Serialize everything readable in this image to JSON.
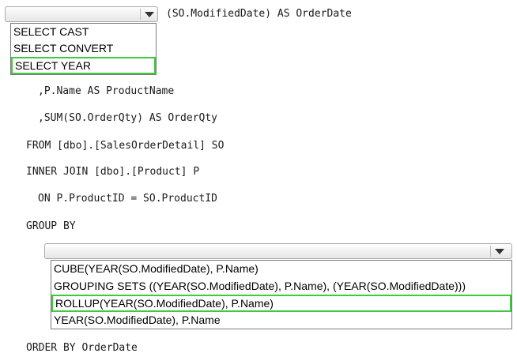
{
  "dropdown1": {
    "options": [
      "SELECT CAST",
      "SELECT CONVERT",
      "SELECT YEAR"
    ],
    "selected_index": 2
  },
  "code": {
    "line_select_suffix": "(SO.ModifiedDate) AS OrderDate",
    "line_product": ",P.Name AS ProductName",
    "line_sum": ",SUM(SO.OrderQty) AS OrderQty",
    "line_from": "FROM [dbo].[SalesOrderDetail] SO",
    "line_join": "INNER JOIN [dbo].[Product] P",
    "line_on": "ON P.ProductID = SO.ProductID",
    "line_group": "GROUP BY",
    "line_order": "ORDER BY OrderDate"
  },
  "dropdown2": {
    "options": [
      "CUBE(YEAR(SO.ModifiedDate), P.Name)",
      "GROUPING SETS ((YEAR(SO.ModifiedDate), P.Name), (YEAR(SO.ModifiedDate)))",
      "ROLLUP(YEAR(SO.ModifiedDate), P.Name)",
      "YEAR(SO.ModifiedDate), P.Name"
    ],
    "selected_index": 2
  },
  "colors": {
    "highlight": "#3ec93e",
    "text": "#1a1a1a",
    "border": "#a9a9a9"
  }
}
